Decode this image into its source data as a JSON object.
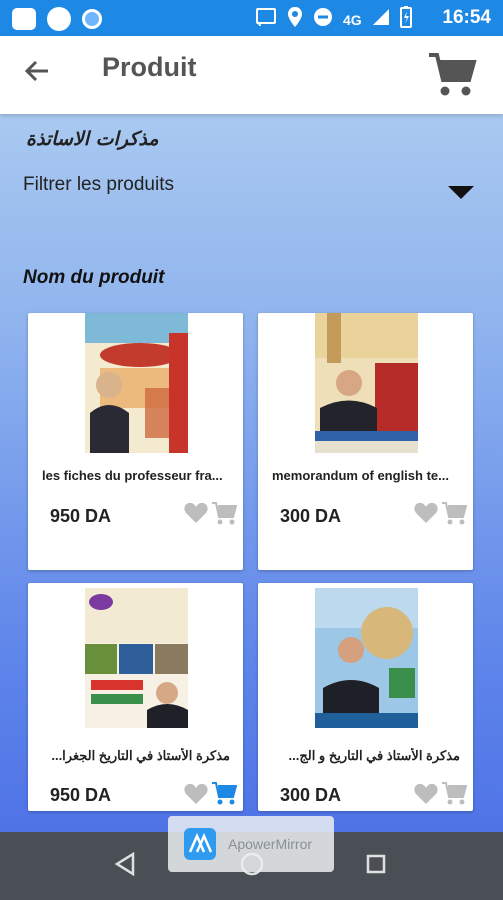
{
  "status_bar": {
    "network": "4G",
    "time": "16:54"
  },
  "app_bar": {
    "title": "Produit"
  },
  "filter": {
    "teachers_label": "مذكرات الاساتذة",
    "label": "Filtrer les produits"
  },
  "section": {
    "title": "Nom du produit"
  },
  "products": [
    {
      "name": "les fiches du professeur fra...",
      "price": "950 DA",
      "cart_active": false
    },
    {
      "name": "memorandum of english te...",
      "price": "300 DA",
      "cart_active": false
    },
    {
      "name": "مذكرة الأستاذ في التاريخ الجغرا...",
      "price": "950 DA",
      "cart_active": true
    },
    {
      "name": "مذكرة الأستاذ في التاريخ و الج...",
      "price": "300 DA",
      "cart_active": false
    }
  ],
  "watermark": {
    "text": "ApowerMirror"
  },
  "colors": {
    "status_bar": "#1e88e5",
    "active_cart": "#1e88e5",
    "inactive_icon": "#bdbdbd",
    "nav_bar": "#4a4f55"
  }
}
